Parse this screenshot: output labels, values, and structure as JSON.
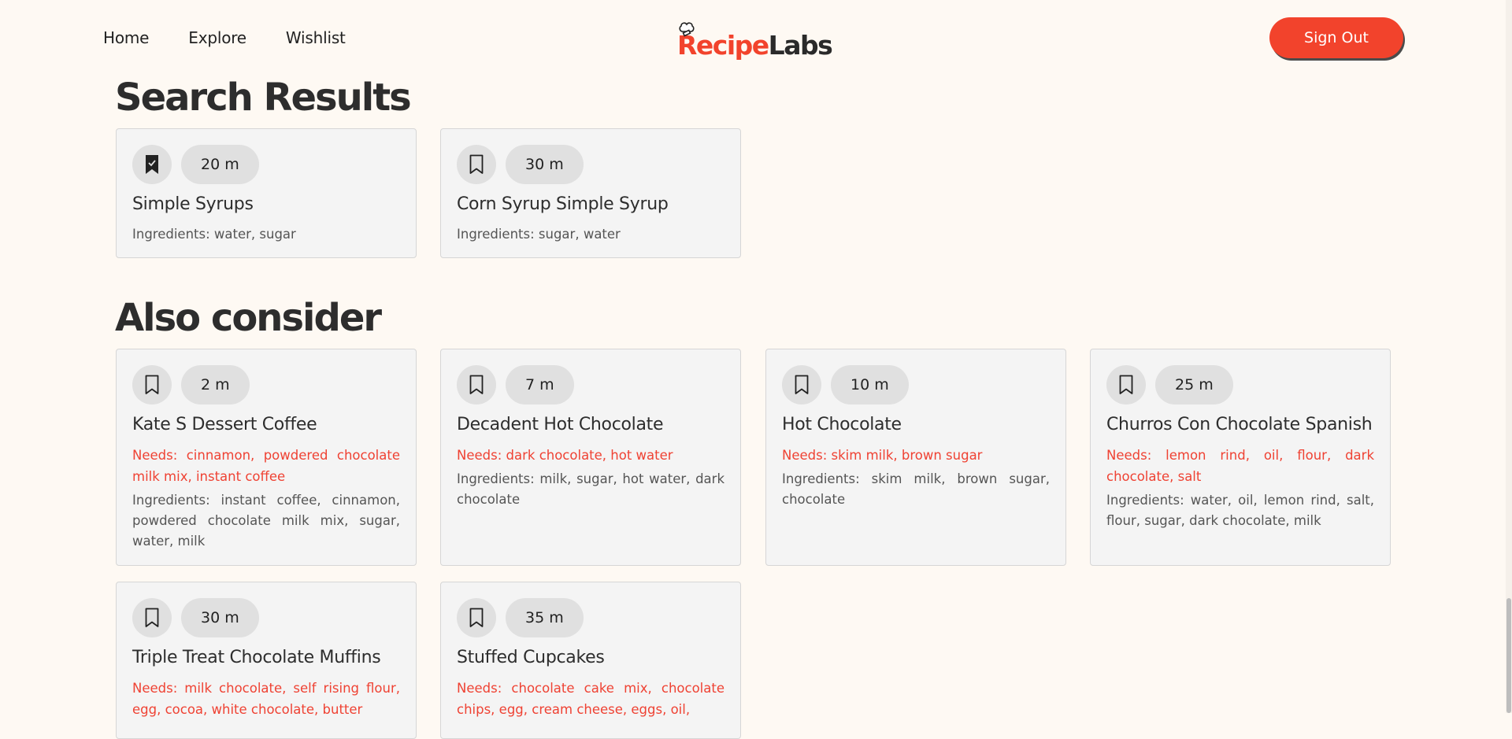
{
  "nav": {
    "links": [
      {
        "label": "Home"
      },
      {
        "label": "Explore"
      },
      {
        "label": "Wishlist"
      }
    ],
    "logo": {
      "part1": "Recipe",
      "part2": "Labs"
    },
    "sign_out": "Sign Out"
  },
  "sections": {
    "search_results": "Search Results",
    "also_consider": "Also consider"
  },
  "search_results": [
    {
      "time": "20 m",
      "title": "Simple Syrups",
      "needs": "",
      "ingredients": "Ingredients: water, sugar",
      "saved": true
    },
    {
      "time": "30 m",
      "title": "Corn Syrup Simple Syrup",
      "needs": "",
      "ingredients": "Ingredients: sugar, water",
      "saved": false
    }
  ],
  "also_consider": [
    {
      "time": "2 m",
      "title": "Kate S Dessert Coffee",
      "needs": "Needs: cinnamon, powdered chocolate milk mix, instant coffee",
      "ingredients": "Ingredients: instant coffee, cinnamon, powdered chocolate milk mix, sugar, water, milk",
      "saved": false
    },
    {
      "time": "7 m",
      "title": "Decadent Hot Chocolate",
      "needs": "Needs: dark chocolate, hot water",
      "ingredients": "Ingredients: milk, sugar, hot water, dark chocolate",
      "saved": false
    },
    {
      "time": "10 m",
      "title": "Hot Chocolate",
      "needs": "Needs: skim milk, brown sugar",
      "ingredients": "Ingredients: skim milk, brown sugar, chocolate",
      "saved": false
    },
    {
      "time": "25 m",
      "title": "Churros Con Chocolate Spanish",
      "needs": "Needs: lemon rind, oil, flour, dark chocolate, salt",
      "ingredients": "Ingredients: water, oil, lemon rind, salt, flour, sugar, dark chocolate, milk",
      "saved": false
    },
    {
      "time": "30 m",
      "title": "Triple Treat Chocolate Muffins",
      "needs": "Needs: milk chocolate, self rising flour, egg, cocoa, white chocolate, butter",
      "ingredients": "",
      "saved": false
    },
    {
      "time": "35 m",
      "title": "Stuffed Cupcakes",
      "needs": "Needs: chocolate cake mix, chocolate chips, egg, cream cheese, eggs, oil,",
      "ingredients": "",
      "saved": false
    }
  ],
  "colors": {
    "accent": "#f2432c",
    "background": "#fef9f3",
    "card": "#f4f4f4",
    "needs_text": "#ef4233"
  }
}
